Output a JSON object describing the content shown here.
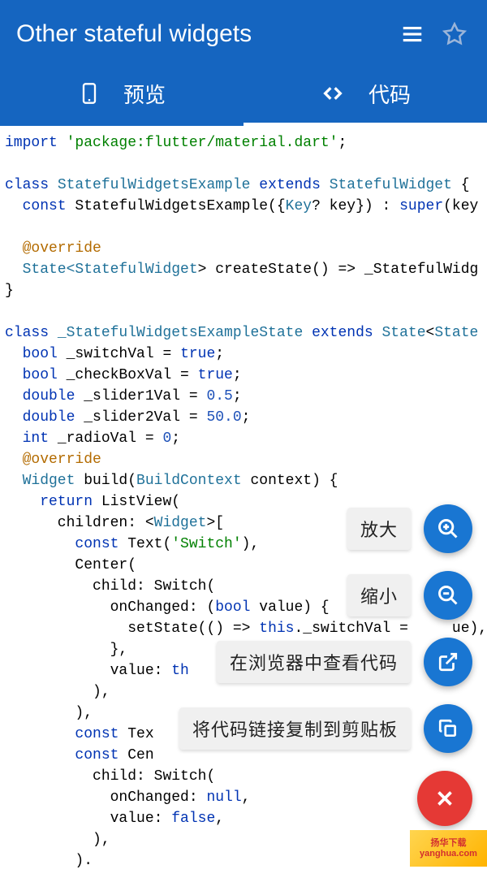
{
  "header": {
    "title": "Other stateful widgets"
  },
  "tabs": {
    "preview": "预览",
    "code": "代码"
  },
  "code": {
    "l1a": "import ",
    "l1b": "'package:flutter/material.dart'",
    "l1c": ";",
    "l2a": "class ",
    "l2b": "StatefulWidgetsExample ",
    "l2c": "extends ",
    "l2d": "StatefulWidget ",
    "l2e": "{",
    "l3a": "  const ",
    "l3b": "StatefulWidgetsExample({",
    "l3c": "Key",
    "l3d": "? key}) : ",
    "l3e": "super",
    "l3f": "(key",
    "l4": "  @override",
    "l5a": "  State<",
    "l5b": "StatefulWidget",
    "l5c": "> createState() => _StatefulWidg",
    "l6": "}",
    "l7a": "class ",
    "l7b": "_StatefulWidgetsExampleState ",
    "l7c": "extends ",
    "l7d": "State",
    "l7e": "<",
    "l7f": "State",
    "l8a": "  bool ",
    "l8b": "_switchVal = ",
    "l8c": "true",
    "l8d": ";",
    "l9a": "  bool ",
    "l9b": "_checkBoxVal = ",
    "l9c": "true",
    "l9d": ";",
    "l10a": "  double ",
    "l10b": "_slider1Val = ",
    "l10c": "0.5",
    "l10d": ";",
    "l11a": "  double ",
    "l11b": "_slider2Val = ",
    "l11c": "50.0",
    "l11d": ";",
    "l12a": "  int ",
    "l12b": "_radioVal = ",
    "l12c": "0",
    "l12d": ";",
    "l13": "  @override",
    "l14a": "  Widget ",
    "l14b": "build(",
    "l14c": "BuildContext ",
    "l14d": "context) {",
    "l15a": "    return ",
    "l15b": "ListView(",
    "l16a": "      children: <",
    "l16b": "Widget",
    "l16c": ">[",
    "l17a": "        const ",
    "l17b": "Text(",
    "l17c": "'Switch'",
    "l17d": "),",
    "l18": "        Center(",
    "l19a": "          child: ",
    "l19b": "Switch(",
    "l20a": "            onChanged: (",
    "l20b": "bool ",
    "l20c": "value) {",
    "l21a": "              setState(() => ",
    "l21b": "this",
    "l21c": "._switchVal =     ue),",
    "l22": "            },",
    "l23a": "            value: ",
    "l23b": "th",
    "l24": "          ),",
    "l25": "        ),",
    "l26a": "        const ",
    "l26b": "Tex",
    "l27a": "        const ",
    "l27b": "Cen",
    "l28a": "          child: ",
    "l28b": "Switch(",
    "l29a": "            onChanged: ",
    "l29b": "null",
    "l29c": ",",
    "l30a": "            value: ",
    "l30b": "false",
    "l30c": ",",
    "l31": "          ),",
    "l32": "        )."
  },
  "fabs": {
    "zoom_in": "放大",
    "zoom_out": "缩小",
    "view_in_browser": "在浏览器中查看代码",
    "copy_link": "将代码链接复制到剪贴板"
  },
  "watermark": "扬华下载\nyanghua.com"
}
